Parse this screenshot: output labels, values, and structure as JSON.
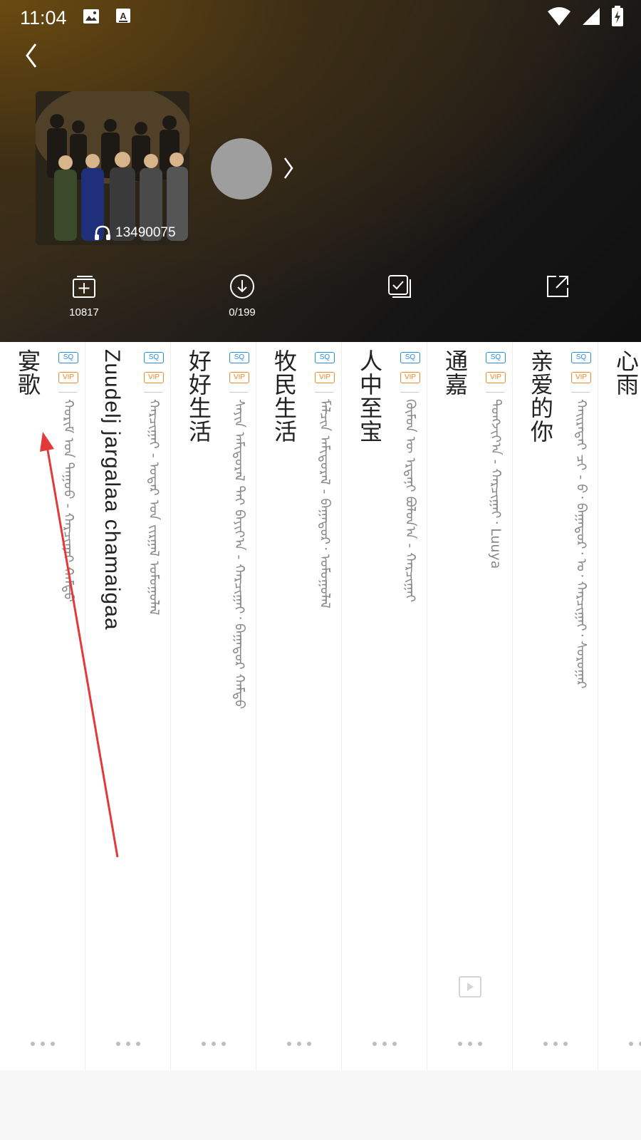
{
  "status_bar": {
    "time": "11:04",
    "left_icons": [
      "image-icon",
      "text-a-icon"
    ],
    "right_icons": [
      "wifi-icon",
      "signal-icon",
      "battery-charging-icon"
    ]
  },
  "header": {
    "back_icon": "chevron-left-icon",
    "play_count": "13490075",
    "actions": [
      {
        "icon": "add-to-folder-icon",
        "label": "10817"
      },
      {
        "icon": "download-icon",
        "label": "0/199"
      },
      {
        "icon": "multi-select-icon",
        "label": ""
      },
      {
        "icon": "share-icon",
        "label": ""
      }
    ]
  },
  "songs": [
    {
      "title": "宴歌",
      "sq": "SQ",
      "vip": "VIP",
      "artist": "ᠬᠤᠷᠢᠮ ᠤᠨ ᠳᠠᠭᠤᠤ - ᠬᠠᠷᠴᠢᠭᠠᠢ ᠬᠠᠮᠲᠤ"
    },
    {
      "title": "Zuudelj jargalaa chamaigaa",
      "sq": "SQ",
      "vip": "VIP",
      "artist": "ᠬᠠᠷᠴᠢᠭᠠᠢ - ᠤᠳᠠᠷ ᠤᠨ ᠵᠢᠷᠭᠠᠯ ᠤᠮᠤᠭᠤᠯᠠᠯ"
    },
    {
      "title": "好好生活",
      "sq": "SQ",
      "vip": "VIP",
      "artist": "ᠰᠠᠶᠢᠨ ᠠᠮᠢᠳᠤᠷᠠᠯ ᠲᠠᠢ ᠪᠠᠶᠢᠶ᠎ᠠ - ᠬᠠᠷᠴᠢᠭᠠᠢ᠂ ᠪᠠᠭᠠᠲᠤᠷ ᠬᠠᠮᠲᠤ"
    },
    {
      "title": "牧民生活",
      "sq": "SQ",
      "vip": "VIP",
      "artist": "ᠮᠠᠯᠴᠢᠨ ᠠᠮᠢᠳᠤᠷᠠᠯ - ᠪᠠᠭᠠᠲᠤᠷ᠂ ᠤᠮᠤᠭᠤᠯᠠᠯ"
    },
    {
      "title": "人中至宝",
      "sq": "SQ",
      "vip": "VIP",
      "artist": "ᠬᠦᠮᠦᠨ ᠦ ᠡᠷᠳᠡᠨᠢ ᠪᠤᠯᠤᠨ᠎ᠠ - ᠬᠠᠷᠴᠢᠭᠠᠢ"
    },
    {
      "title": "通嘉",
      "sq": "SQ",
      "vip": "VIP",
      "artist": "ᠲᠤᠩᠵᠢᠶ᠎ᠠ - ᠬᠠᠷᠴᠢᠭᠠᠢ᠂ Luuya"
    },
    {
      "title": "亲爱的你",
      "sq": "SQ",
      "vip": "VIP",
      "artist": "ᠬᠠᠢᠷᠠᠲᠠᠢ ᠴᠢ - ᠪ᠂ ᠪᠠᠭᠠᠲᠤᠷ᠂ ᠤ᠂ ᠬᠠᠷᠴᠢᠭᠠᠢ᠂ ᠰᠤᠷᠤᠭᠠᠷ"
    },
    {
      "title": "心雨",
      "sq": "",
      "vip": "",
      "artist": ""
    }
  ],
  "colors": {
    "sq_badge": "#2a8ee8",
    "vip_badge": "#f08a2a",
    "annotation_arrow": "#e23a3a"
  }
}
